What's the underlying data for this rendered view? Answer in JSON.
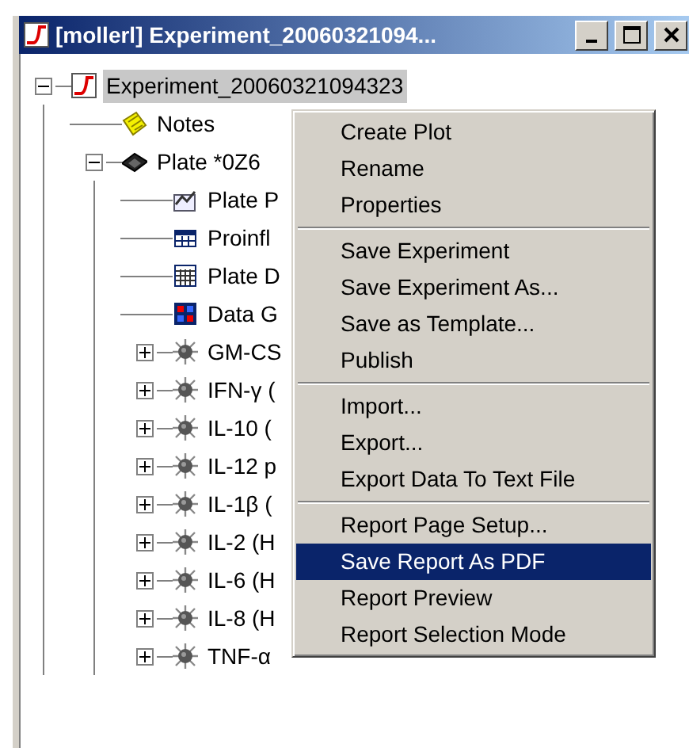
{
  "window": {
    "title": "[mollerl] Experiment_20060321094..."
  },
  "tree": [
    {
      "label": "Experiment_20060321094323",
      "kind": "experiment",
      "selected": true,
      "expanded": true,
      "children": [
        {
          "label": "Notes",
          "kind": "notes",
          "selected": false
        },
        {
          "label": "Plate  *0Z6",
          "kind": "plate",
          "selected": false,
          "expanded": true,
          "children": [
            {
              "label": "Plate P",
              "kind": "plot",
              "selected": false
            },
            {
              "label": "Proinfl",
              "kind": "table",
              "selected": false
            },
            {
              "label": "Plate D",
              "kind": "grid",
              "selected": false
            },
            {
              "label": "Data G",
              "kind": "heatmap",
              "selected": false
            },
            {
              "label": "GM-CS",
              "kind": "analyte",
              "selected": false,
              "expanded": false
            },
            {
              "label": "IFN-γ (",
              "kind": "analyte",
              "selected": false,
              "expanded": false
            },
            {
              "label": "IL-10 (",
              "kind": "analyte",
              "selected": false,
              "expanded": false
            },
            {
              "label": "IL-12 p",
              "kind": "analyte",
              "selected": false,
              "expanded": false
            },
            {
              "label": "IL-1β (",
              "kind": "analyte",
              "selected": false,
              "expanded": false
            },
            {
              "label": "IL-2 (H",
              "kind": "analyte",
              "selected": false,
              "expanded": false
            },
            {
              "label": "IL-6 (H",
              "kind": "analyte",
              "selected": false,
              "expanded": false
            },
            {
              "label": "IL-8 (H",
              "kind": "analyte",
              "selected": false,
              "expanded": false
            },
            {
              "label": "TNF-α",
              "kind": "analyte",
              "selected": false,
              "expanded": false
            }
          ]
        }
      ]
    }
  ],
  "context_menu": [
    [
      {
        "label": "Create Plot",
        "selected": false
      },
      {
        "label": "Rename",
        "selected": false
      },
      {
        "label": "Properties",
        "selected": false
      }
    ],
    [
      {
        "label": "Save Experiment",
        "selected": false
      },
      {
        "label": "Save Experiment As...",
        "selected": false
      },
      {
        "label": "Save as Template...",
        "selected": false
      },
      {
        "label": "Publish",
        "selected": false
      }
    ],
    [
      {
        "label": "Import...",
        "selected": false
      },
      {
        "label": "Export...",
        "selected": false
      },
      {
        "label": "Export Data To Text File",
        "selected": false
      }
    ],
    [
      {
        "label": "Report Page Setup...",
        "selected": false
      },
      {
        "label": "Save Report As PDF",
        "selected": true
      },
      {
        "label": "Report Preview",
        "selected": false
      },
      {
        "label": "Report Selection Mode",
        "selected": false
      }
    ]
  ]
}
